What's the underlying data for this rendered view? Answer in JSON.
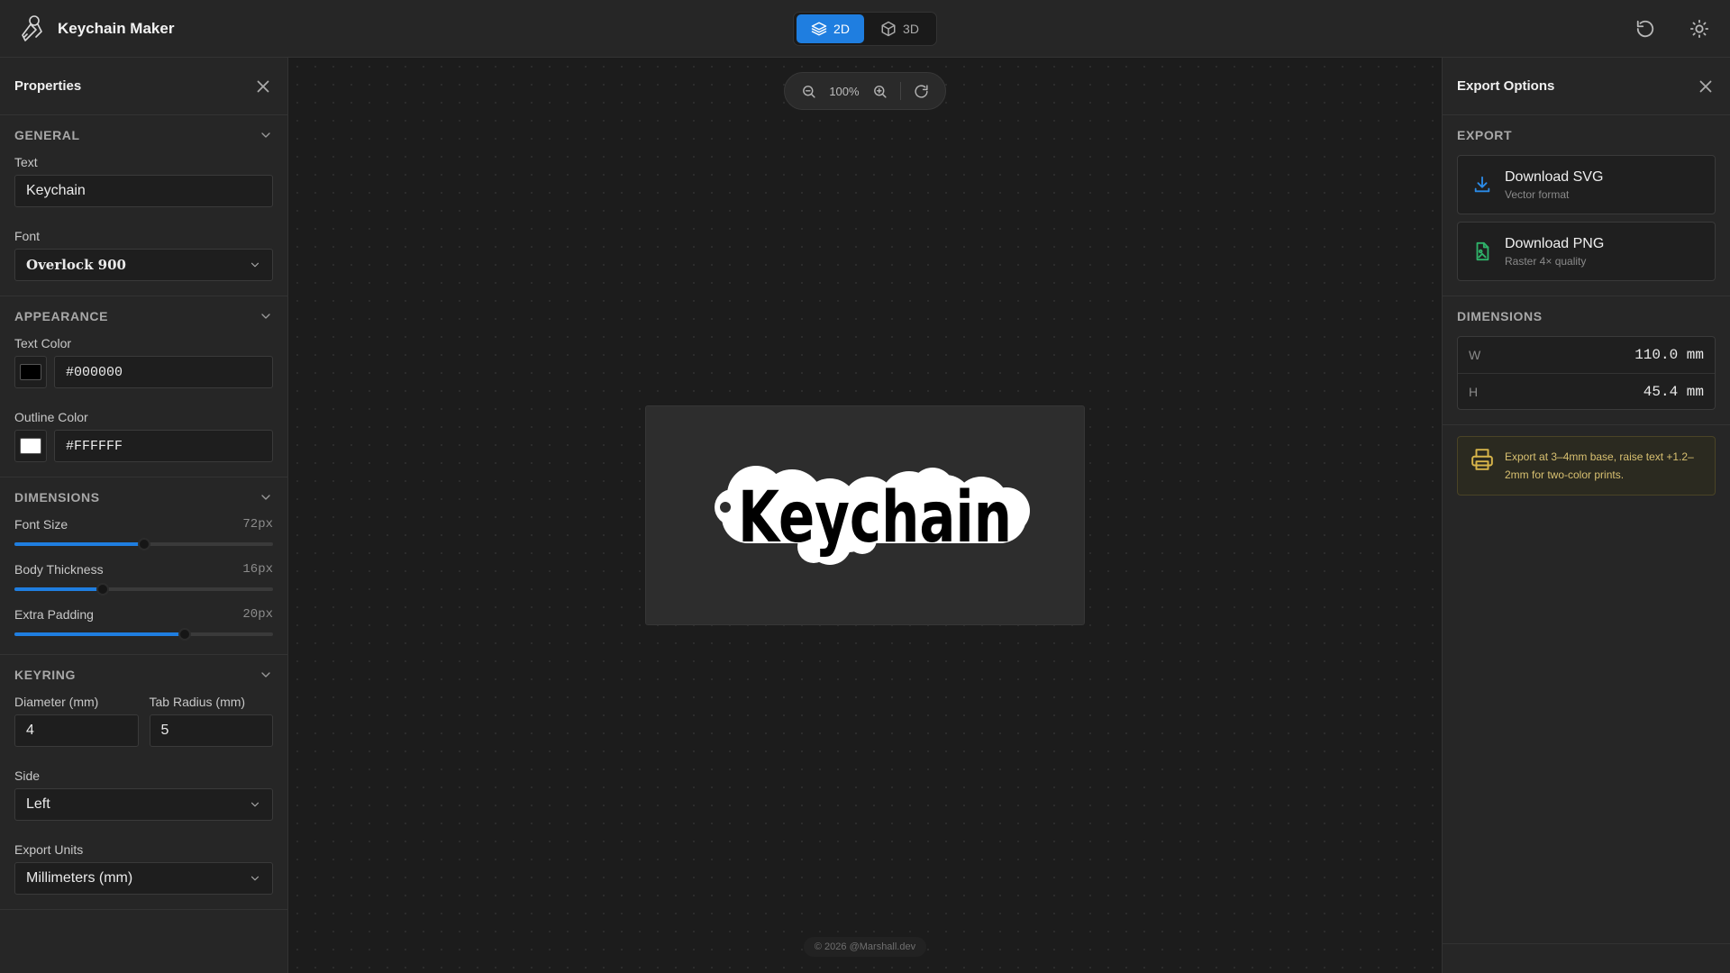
{
  "app": {
    "title": "Keychain Maker"
  },
  "mode": {
    "options": [
      "2D",
      "3D"
    ],
    "active": "2D"
  },
  "properties": {
    "title": "Properties",
    "general": {
      "heading": "GENERAL",
      "text_label": "Text",
      "text_value": "Keychain",
      "font_label": "Font",
      "font_value": "Overlock 900"
    },
    "appearance": {
      "heading": "APPEARANCE",
      "text_color_label": "Text Color",
      "text_color_value": "#000000",
      "outline_color_label": "Outline Color",
      "outline_color_value": "#FFFFFF"
    },
    "dimensions": {
      "heading": "DIMENSIONS",
      "font_size_label": "Font Size",
      "font_size_value": "72px",
      "font_size_fraction": 0.5,
      "body_thickness_label": "Body Thickness",
      "body_thickness_value": "16px",
      "body_thickness_fraction": 0.34,
      "extra_padding_label": "Extra Padding",
      "extra_padding_value": "20px",
      "extra_padding_fraction": 0.66
    },
    "keyring": {
      "heading": "KEYRING",
      "diameter_label": "Diameter (mm)",
      "diameter_value": "4",
      "tab_radius_label": "Tab Radius (mm)",
      "tab_radius_value": "5",
      "side_label": "Side",
      "side_value": "Left",
      "export_units_label": "Export Units",
      "export_units_value": "Millimeters (mm)"
    }
  },
  "canvas": {
    "zoom_level": "100%",
    "preview_text": "Keychain",
    "footer": "© 2026 @Marshall.dev"
  },
  "export_panel": {
    "title": "Export Options",
    "export_heading": "EXPORT",
    "svg_label": "Download SVG",
    "svg_sub": "Vector format",
    "png_label": "Download PNG",
    "png_sub": "Raster 4× quality",
    "dimensions_heading": "DIMENSIONS",
    "width_key": "W",
    "width_value": "110.0 mm",
    "height_key": "H",
    "height_value": "45.4 mm",
    "tip": "Export at 3–4mm base, raise text +1.2–2mm for two-color prints."
  },
  "colors": {
    "accent": "#1f7ee0",
    "svg_icon": "#2b8be8",
    "png_icon": "#2fb36a",
    "tip_text": "#d8c070"
  },
  "icons": {
    "logo": "keychain-logo-icon",
    "mode_2d": "layers-icon",
    "mode_3d": "cube-icon",
    "reset": "rotate-ccw-icon",
    "theme": "sun-icon",
    "close": "close-icon",
    "chevron": "chevron-down-icon",
    "zoom_out": "zoom-out-icon",
    "zoom_in": "zoom-in-icon",
    "refresh": "rotate-cw-icon",
    "download": "download-icon",
    "image": "image-file-icon",
    "printer": "printer-icon"
  }
}
